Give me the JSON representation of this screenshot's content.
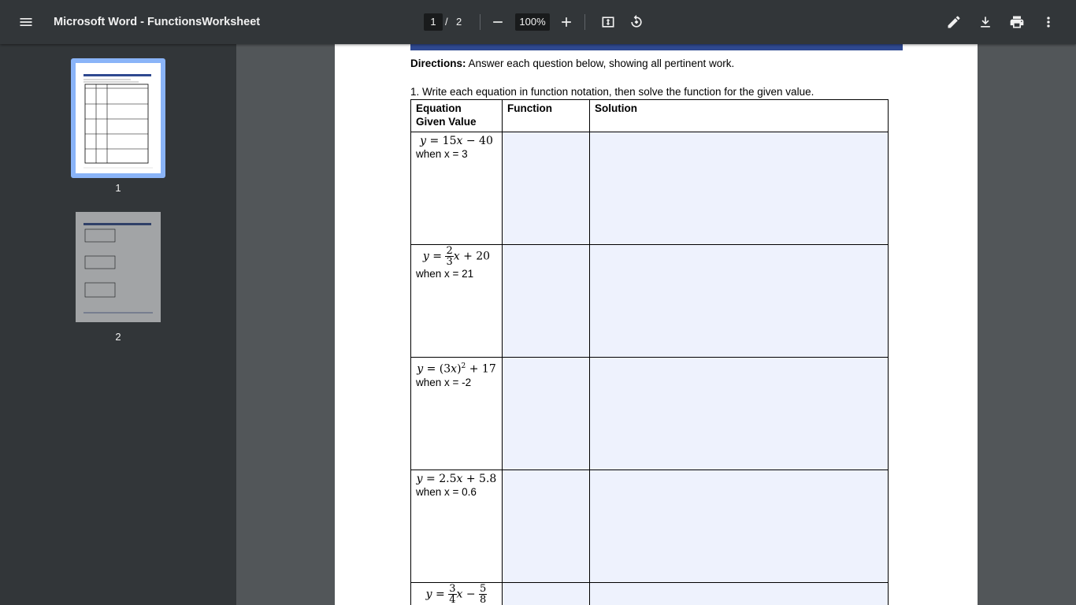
{
  "toolbar": {
    "title": "Microsoft Word - FunctionsWorksheet",
    "current_page": "1",
    "page_separator": "/",
    "total_pages": "2",
    "zoom": "100%",
    "icons": [
      "menu-icon",
      "zoom-out-icon",
      "zoom-in-icon",
      "fit-page-icon",
      "rotate-icon",
      "pen-icon",
      "download-icon",
      "print-icon",
      "more-vert-icon"
    ]
  },
  "sidebar": {
    "thumbnails": [
      {
        "label": "1",
        "selected": true
      },
      {
        "label": "2",
        "selected": false
      }
    ]
  },
  "document": {
    "directions_label": "Directions:",
    "directions_text": " Answer each question below, showing all pertinent work.",
    "question1": "1. Write each equation in function notation, then solve the function for the given value.",
    "table": {
      "headers": {
        "col1_line1": "Equation",
        "col1_line2": "Given Value",
        "col2": "Function",
        "col3": "Solution"
      },
      "rows": [
        {
          "when": "when x = 3"
        },
        {
          "when": "when x = 21"
        },
        {
          "when": "when x = -2"
        },
        {
          "when": "when x = 0.6"
        }
      ]
    }
  },
  "colors": {
    "toolbar_bg": "#323639",
    "viewer_bg": "#525659",
    "selected_thumb": "#8ab4f8",
    "header_band": "#2f4990",
    "cell_shade": "#eef2fd"
  }
}
